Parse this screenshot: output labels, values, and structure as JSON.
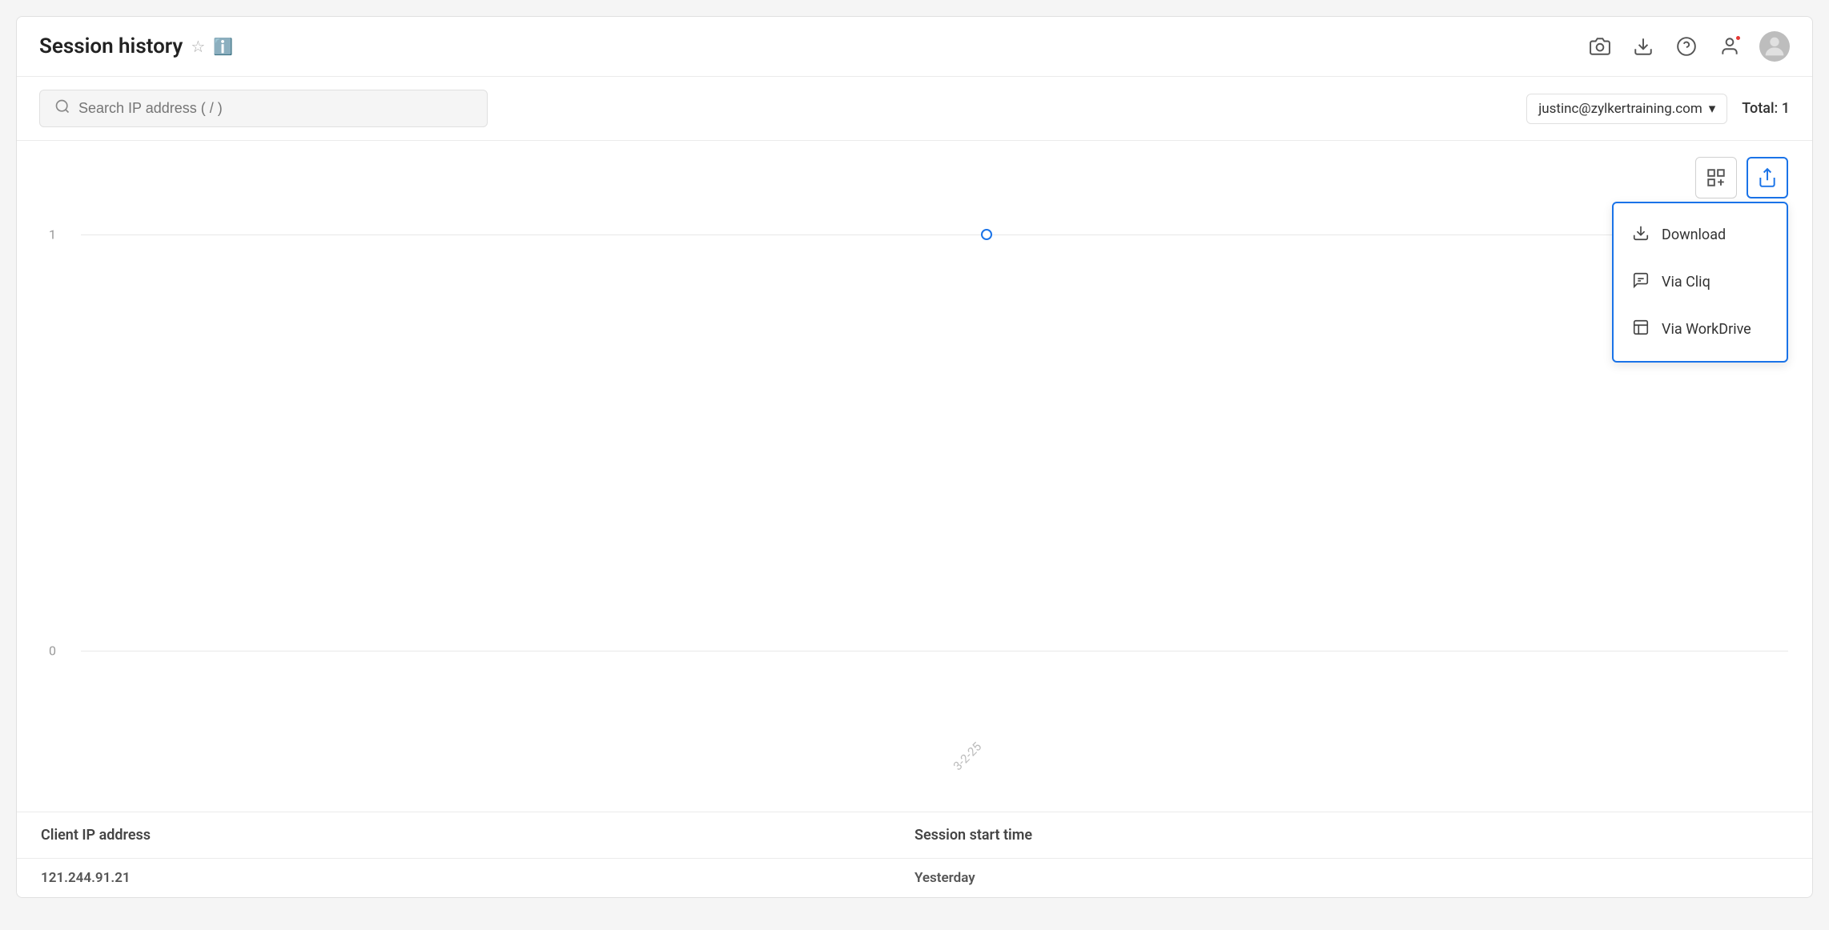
{
  "header": {
    "title": "Session history",
    "star_icon": "★",
    "info_icon": "ℹ",
    "icons": [
      {
        "name": "screenshot-icon",
        "symbol": "⊙"
      },
      {
        "name": "download-icon",
        "symbol": "↓"
      },
      {
        "name": "help-icon",
        "symbol": "?"
      },
      {
        "name": "notifications-icon",
        "symbol": "🔔"
      }
    ],
    "avatar_initial": ""
  },
  "toolbar": {
    "search_placeholder": "Search IP address ( / )",
    "email": "justinc@zylkertraining.com",
    "total_label": "Total: 1"
  },
  "chart": {
    "y_labels": [
      "1",
      "0"
    ],
    "x_label": "3-2-25",
    "point": {
      "x_pct": 54,
      "y_pct": 22
    }
  },
  "export_menu": {
    "items": [
      {
        "label": "Download",
        "icon": "⬇",
        "name": "download-menu-item"
      },
      {
        "label": "Via Cliq",
        "icon": "💬",
        "name": "via-cliq-menu-item"
      },
      {
        "label": "Via WorkDrive",
        "icon": "📊",
        "name": "via-workdrive-menu-item"
      }
    ]
  },
  "table": {
    "columns": [
      "Client IP address",
      "Session start time"
    ],
    "rows": [
      {
        "ip": "121.244.91.21",
        "session": "Yesterday"
      }
    ]
  }
}
